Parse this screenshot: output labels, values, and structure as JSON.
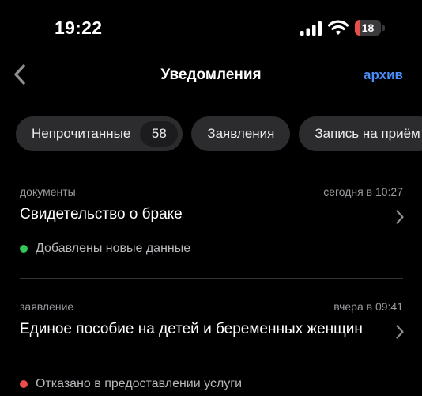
{
  "status_bar": {
    "time": "19:22",
    "battery_level": "18",
    "battery_fraction": 0.18,
    "battery_color": "#eb4d4b",
    "icons": [
      "signal-bars-icon",
      "wifi-icon",
      "battery-icon"
    ]
  },
  "nav": {
    "back_icon": "chevron-left-icon",
    "title": "Уведомления",
    "archive_label": "архив",
    "accent_color": "#4a8df8"
  },
  "filters": [
    {
      "label": "Непрочитанные",
      "count": "58"
    },
    {
      "label": "Заявления"
    },
    {
      "label": "Запись на приём"
    }
  ],
  "notifications": [
    {
      "category": "документы",
      "time": "сегодня в 10:27",
      "title": "Свидетельство о браке",
      "status": "Добавлены новые данные",
      "status_color": "#34c759"
    },
    {
      "category": "заявление",
      "time": "вчера в 09:41",
      "title": "Единое пособие на детей и беременных женщин",
      "status": "Отказано в предоставлении услуги",
      "status_color": "#eb4d4b"
    }
  ]
}
